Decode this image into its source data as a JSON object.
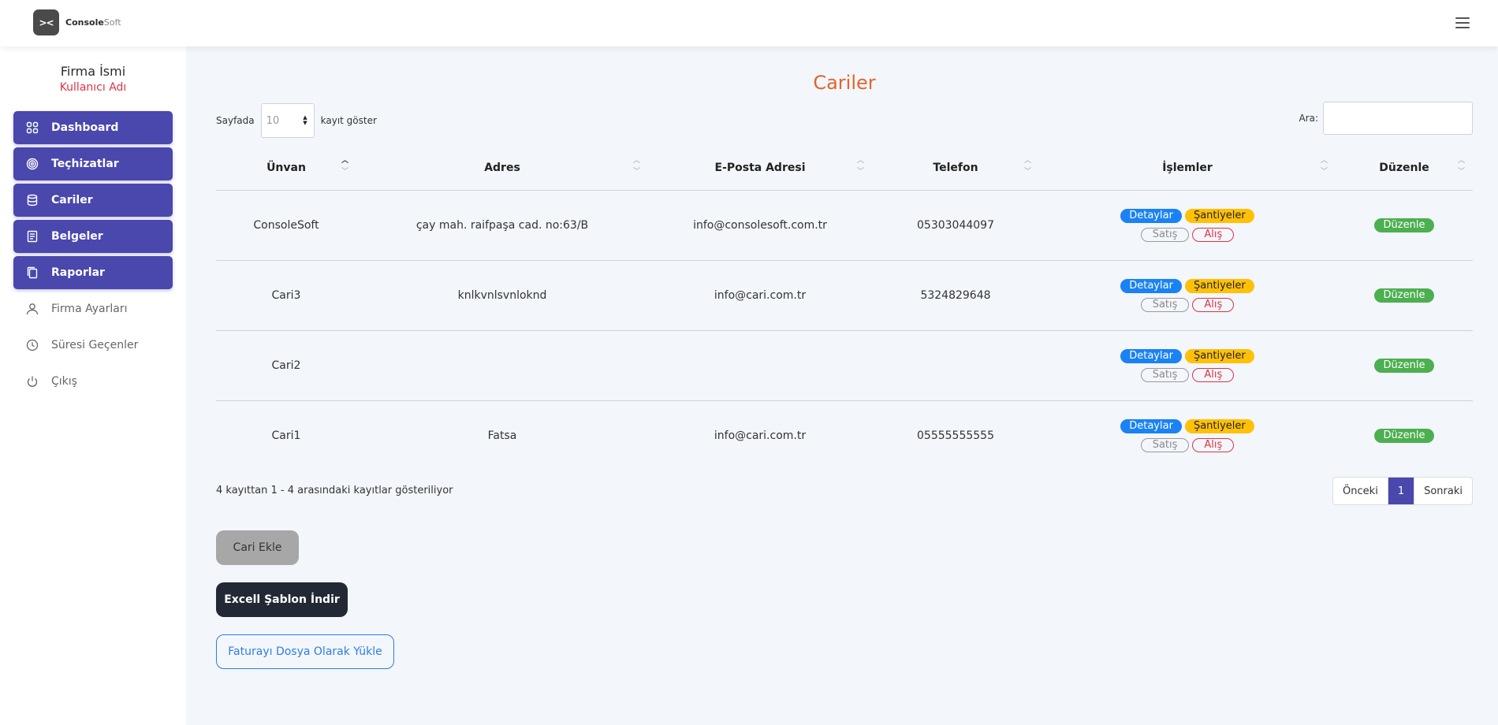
{
  "header": {
    "logo_mark": "><",
    "brand_bold": "Console",
    "brand_light": "Soft"
  },
  "sidebar": {
    "company": "Firma İsmi",
    "user": "Kullanıcı Adı",
    "items": [
      {
        "label": "Dashboard",
        "icon": "grid-icon"
      },
      {
        "label": "Teçhizatlar",
        "icon": "target-icon"
      },
      {
        "label": "Cariler",
        "icon": "database-icon"
      },
      {
        "label": "Belgeler",
        "icon": "document-icon"
      },
      {
        "label": "Raporlar",
        "icon": "copy-icon"
      },
      {
        "label": "Firma Ayarları",
        "icon": "user-icon"
      },
      {
        "label": "Süresi Geçenler",
        "icon": "clock-icon"
      },
      {
        "label": "Çıkış",
        "icon": "power-icon"
      }
    ]
  },
  "main": {
    "title": "Cariler",
    "length": {
      "prefix": "Sayfada",
      "value": "10",
      "suffix": "kayıt göster"
    },
    "search": {
      "label": "Ara:",
      "value": ""
    },
    "columns": [
      "Ünvan",
      "Adres",
      "E-Posta Adresi",
      "Telefon",
      "İşlemler",
      "Düzenle"
    ],
    "rows": [
      {
        "unvan": "ConsoleSoft",
        "adres": "çay mah. raifpaşa cad. no:63/B",
        "eposta": "info@consolesoft.com.tr",
        "telefon": "05303044097"
      },
      {
        "unvan": "Cari3",
        "adres": "knlkvnlsvnloknd",
        "eposta": "info@cari.com.tr",
        "telefon": "5324829648"
      },
      {
        "unvan": "Cari2",
        "adres": "",
        "eposta": "",
        "telefon": ""
      },
      {
        "unvan": "Cari1",
        "adres": "Fatsa",
        "eposta": "info@cari.com.tr",
        "telefon": "05555555555"
      }
    ],
    "actions": {
      "details": "Detaylar",
      "sites": "Şantiyeler",
      "sale": "Satış",
      "purchase": "Alış",
      "edit": "Düzenle"
    },
    "info": "4 kayıttan 1 - 4 arasındaki kayıtlar gösteriliyor",
    "pager": {
      "prev": "Önceki",
      "current": "1",
      "next": "Sonraki"
    },
    "buttons": {
      "add": "Cari Ekle",
      "excel": "Excell Şablon İndir",
      "upload": "Faturayı Dosya Olarak Yükle"
    }
  },
  "colors": {
    "primary": "#4a47ad",
    "title": "#e0662b",
    "accent_red": "#dc3545"
  }
}
